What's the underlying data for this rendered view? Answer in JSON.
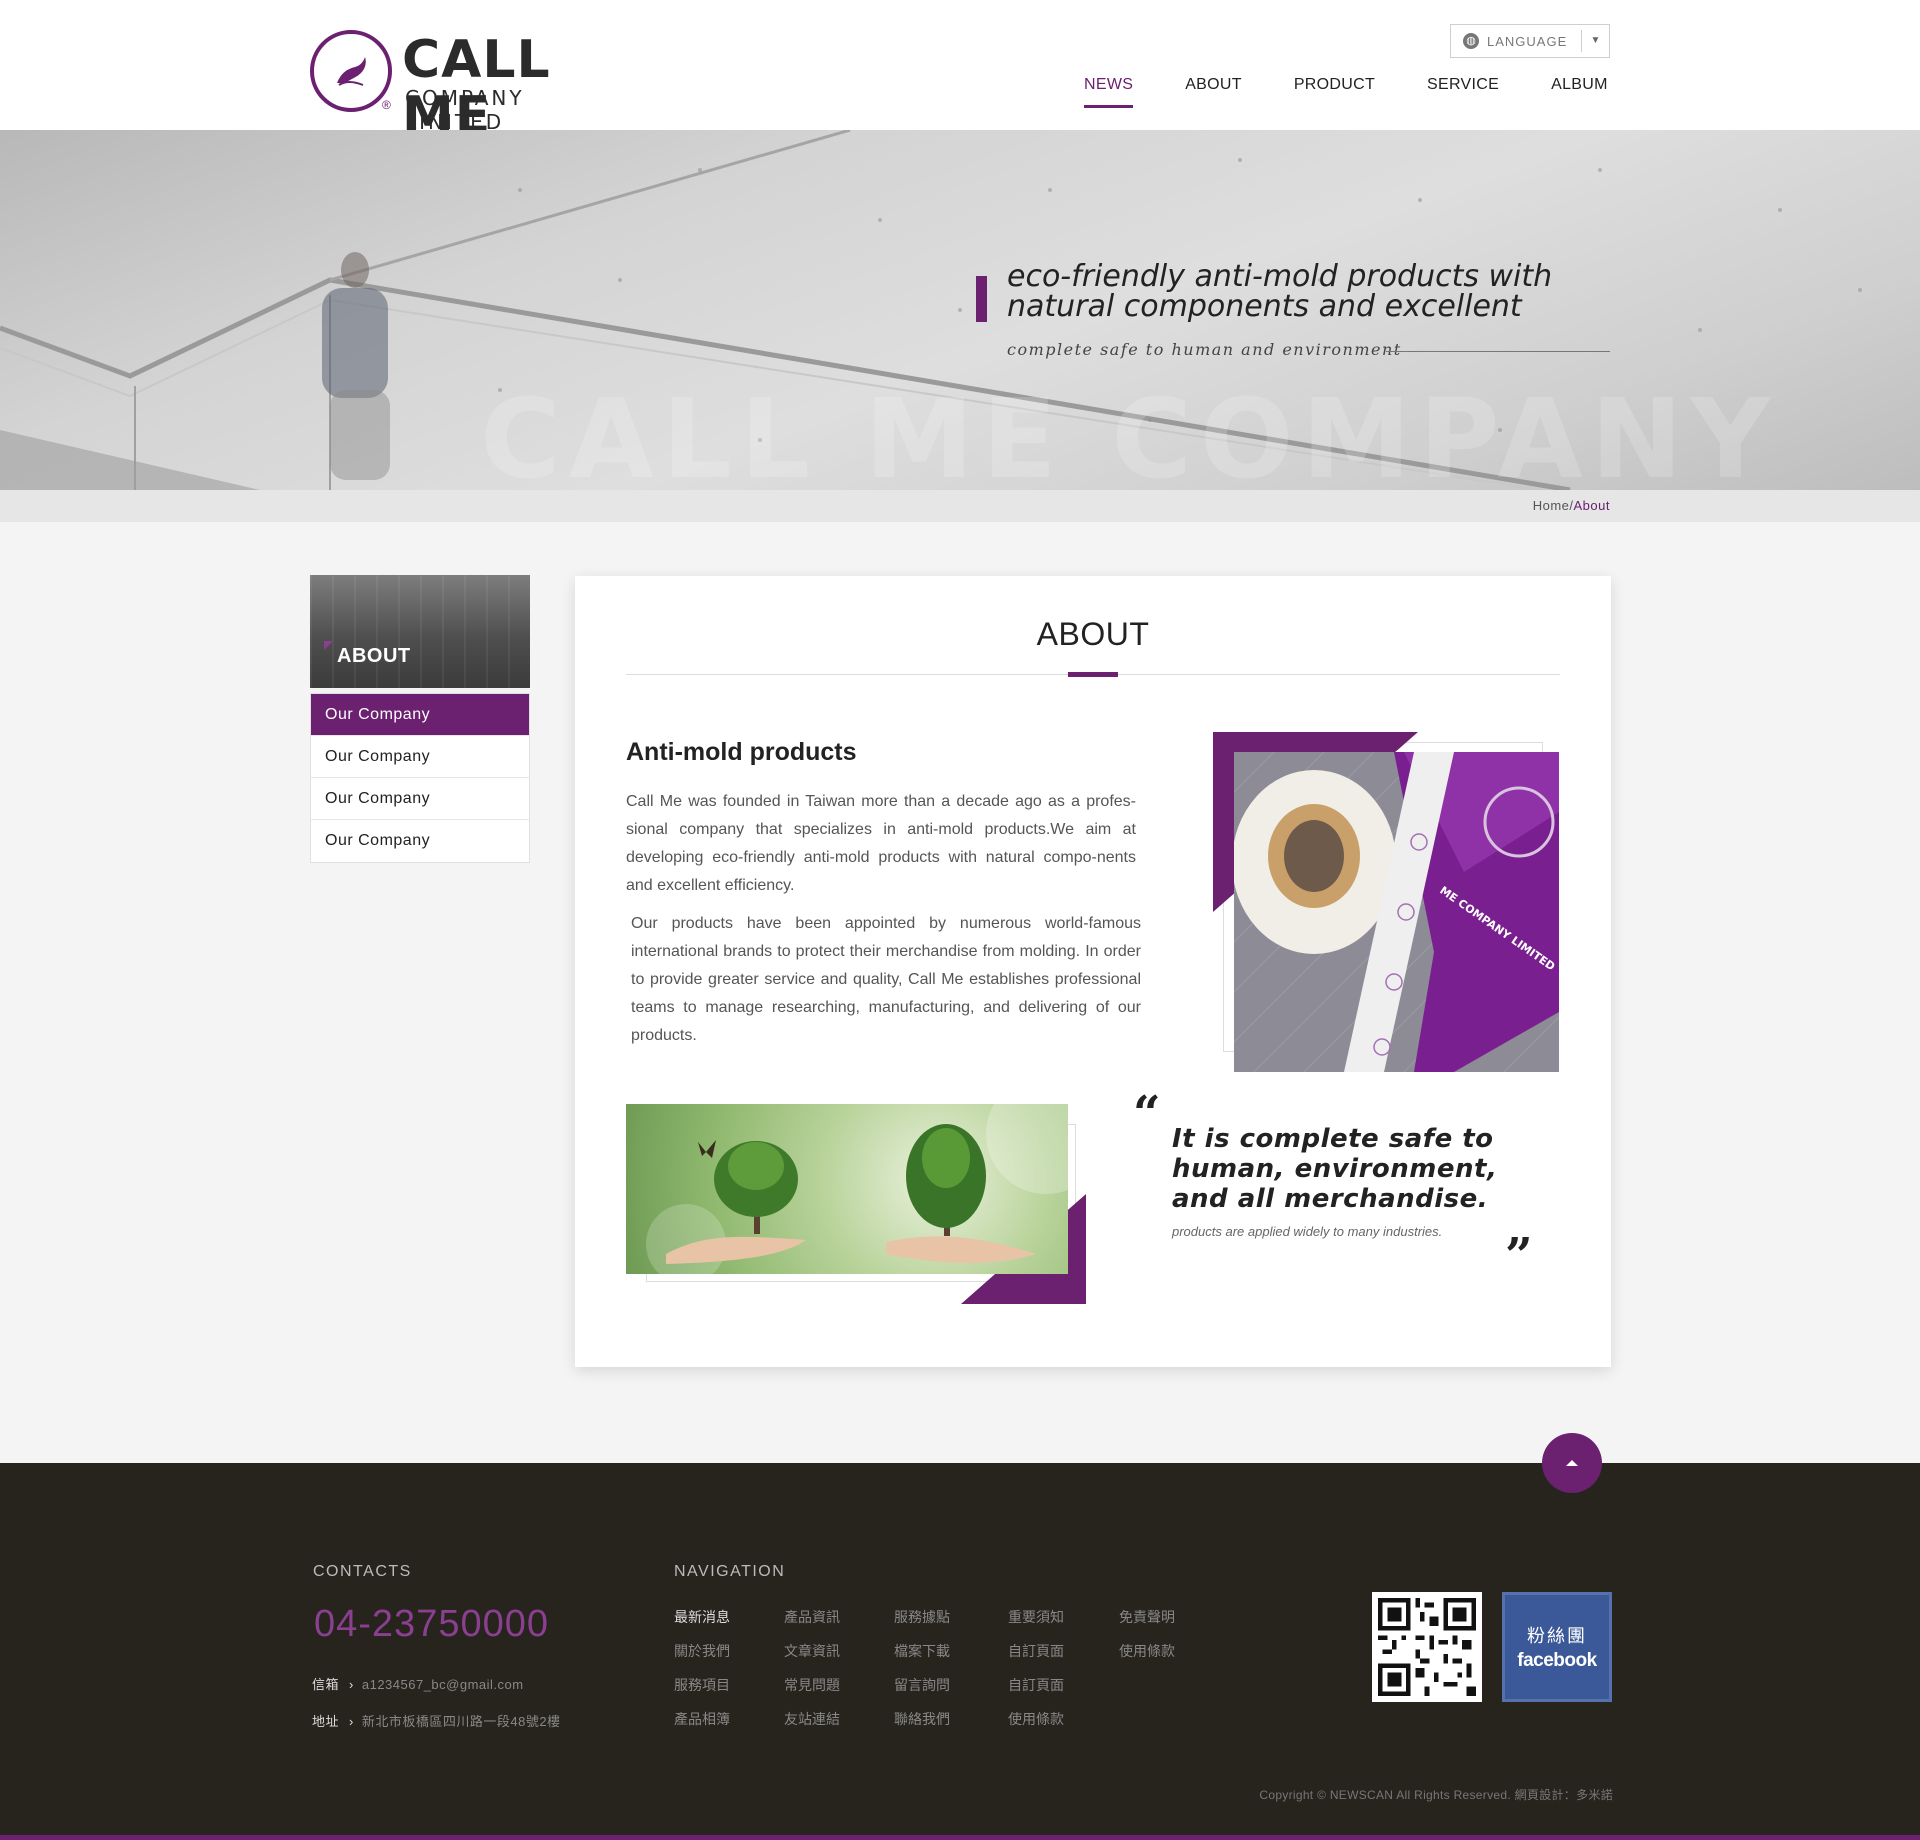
{
  "header": {
    "logo_title": "CALL ME",
    "logo_subtitle": "COMPANY LINITED",
    "logo_reg": "®",
    "language_label": "LANGUAGE",
    "nav": [
      {
        "label": "NEWS",
        "active": true
      },
      {
        "label": "ABOUT",
        "active": false
      },
      {
        "label": "PRODUCT",
        "active": false
      },
      {
        "label": "SERVICE",
        "active": false
      },
      {
        "label": "ALBUM",
        "active": false
      }
    ]
  },
  "banner": {
    "headline": "eco-friendly anti-mold products with natural components and excellent",
    "subline": "complete safe to human and environment",
    "watermark": "CALL ME COMPANY"
  },
  "breadcrumb": {
    "home": "Home",
    "separator": "/",
    "current": "About"
  },
  "sidebar": {
    "title": "ABOUT",
    "items": [
      {
        "label": "Our Company",
        "active": true
      },
      {
        "label": "Our Company",
        "active": false
      },
      {
        "label": "Our Company",
        "active": false
      },
      {
        "label": "Our Company",
        "active": false
      }
    ]
  },
  "main": {
    "title": "ABOUT",
    "section_title": "Anti-mold products",
    "paragraph_1": "Call Me was founded in Taiwan more than a decade ago as a profes-sional company that specializes in anti-mold products.We aim at developing eco-friendly anti-mold products with natural compo-nents and excellent efficiency.",
    "paragraph_2": "Our products have been appointed by numerous world-famous international brands to protect their merchandise from molding. In order to provide greater service and quality, Call Me establishes professional teams to manage researching, manufacturing, and delivering of our products.",
    "product_label": "ME COMPANY LIMITED",
    "quote_open": "“",
    "quote": "It is complete safe to human, environment, and all merchandise.",
    "quote_sub": "products are applied widely to many industries.",
    "quote_close": "”"
  },
  "footer": {
    "contacts_heading": "CONTACTS",
    "phone": "04-23750000",
    "email_label": "信箱",
    "email": "a1234567_bc@gmail.com",
    "address_label": "地址",
    "address": "新北市板橋區四川路一段48號2樓",
    "arrow": "›",
    "navigation_heading": "NAVIGATION",
    "nav_links": [
      "最新消息",
      "產品資訊",
      "服務據點",
      "重要須知",
      "免責聲明",
      "關於我們",
      "文章資訊",
      "檔案下載",
      "自訂頁面",
      "使用條款",
      "服務項目",
      "常見問題",
      "留言詢問",
      "自訂頁面",
      "",
      "產品相簿",
      "友站連結",
      "聯絡我們",
      "使用條款",
      ""
    ],
    "facebook_zh": "粉絲團",
    "facebook_en": "facebook",
    "copyright": "Copyright © NEWSCAN All Rights Reserved. 網頁設計：多米諾"
  },
  "colors": {
    "brand": "#6b2070",
    "footer_bg": "#26241c",
    "phone": "#8a3f91"
  },
  "icons": {
    "language": "globe-icon",
    "language_caret": "caret-down-icon",
    "back_to_top": "arrow-up-icon"
  }
}
